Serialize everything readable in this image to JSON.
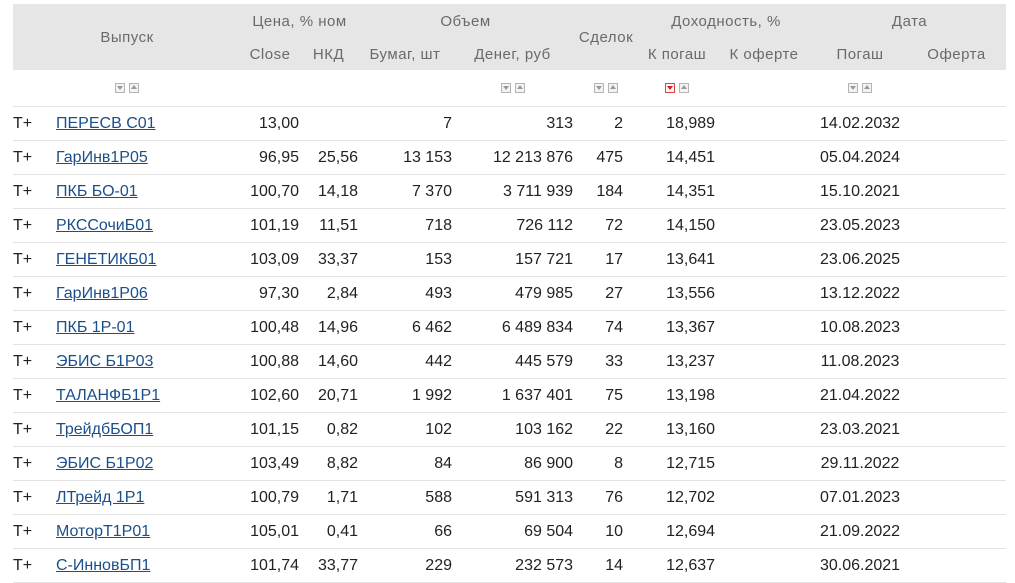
{
  "header": {
    "issue": "Выпуск",
    "price_group": "Цена, % ном",
    "volume_group": "Объем",
    "deals": "Сделок",
    "yield_group": "Доходность, %",
    "date_group": "Дата",
    "close": "Close",
    "nkd": "НКД",
    "papers": "Бумаг, шт",
    "money": "Денег, руб",
    "to_maturity": "К погаш",
    "to_offer": "К оферте",
    "maturity": "Погаш",
    "offer": "Оферта"
  },
  "sort_icons": {
    "inactive_icon": "sort-arrow-icon",
    "active_icon": "sort-desc-active-icon",
    "active_color": "#d81e1e"
  },
  "rows": [
    {
      "mode": "T+",
      "issue": "ПЕРЕСВ С01",
      "close": "13,00",
      "nkd": "",
      "papers": "7",
      "money": "313",
      "deals": "2",
      "yield": "18,989",
      "yield_offer": "",
      "maturity": "14.02.2032",
      "offer": ""
    },
    {
      "mode": "T+",
      "issue": "ГарИнв1Р05",
      "close": "96,95",
      "nkd": "25,56",
      "papers": "13 153",
      "money": "12 213 876",
      "deals": "475",
      "yield": "14,451",
      "yield_offer": "",
      "maturity": "05.04.2024",
      "offer": ""
    },
    {
      "mode": "T+",
      "issue": "ПКБ БО-01",
      "close": "100,70",
      "nkd": "14,18",
      "papers": "7 370",
      "money": "3 711 939",
      "deals": "184",
      "yield": "14,351",
      "yield_offer": "",
      "maturity": "15.10.2021",
      "offer": ""
    },
    {
      "mode": "T+",
      "issue": "РКССочиБ01",
      "close": "101,19",
      "nkd": "11,51",
      "papers": "718",
      "money": "726 112",
      "deals": "72",
      "yield": "14,150",
      "yield_offer": "",
      "maturity": "23.05.2023",
      "offer": ""
    },
    {
      "mode": "T+",
      "issue": "ГЕНЕТИКБ01",
      "close": "103,09",
      "nkd": "33,37",
      "papers": "153",
      "money": "157 721",
      "deals": "17",
      "yield": "13,641",
      "yield_offer": "",
      "maturity": "23.06.2025",
      "offer": ""
    },
    {
      "mode": "T+",
      "issue": "ГарИнв1Р06",
      "close": "97,30",
      "nkd": "2,84",
      "papers": "493",
      "money": "479 985",
      "deals": "27",
      "yield": "13,556",
      "yield_offer": "",
      "maturity": "13.12.2022",
      "offer": ""
    },
    {
      "mode": "T+",
      "issue": "ПКБ 1Р-01",
      "close": "100,48",
      "nkd": "14,96",
      "papers": "6 462",
      "money": "6 489 834",
      "deals": "74",
      "yield": "13,367",
      "yield_offer": "",
      "maturity": "10.08.2023",
      "offer": ""
    },
    {
      "mode": "T+",
      "issue": "ЭБИС Б1Р03",
      "close": "100,88",
      "nkd": "14,60",
      "papers": "442",
      "money": "445 579",
      "deals": "33",
      "yield": "13,237",
      "yield_offer": "",
      "maturity": "11.08.2023",
      "offer": ""
    },
    {
      "mode": "T+",
      "issue": "ТАЛАНФБ1Р1",
      "close": "102,60",
      "nkd": "20,71",
      "papers": "1 992",
      "money": "1 637 401",
      "deals": "75",
      "yield": "13,198",
      "yield_offer": "",
      "maturity": "21.04.2022",
      "offer": ""
    },
    {
      "mode": "T+",
      "issue": "ТрейдбБОП1",
      "close": "101,15",
      "nkd": "0,82",
      "papers": "102",
      "money": "103 162",
      "deals": "22",
      "yield": "13,160",
      "yield_offer": "",
      "maturity": "23.03.2021",
      "offer": ""
    },
    {
      "mode": "T+",
      "issue": "ЭБИС Б1Р02",
      "close": "103,49",
      "nkd": "8,82",
      "papers": "84",
      "money": "86 900",
      "deals": "8",
      "yield": "12,715",
      "yield_offer": "",
      "maturity": "29.11.2022",
      "offer": ""
    },
    {
      "mode": "T+",
      "issue": "ЛТрейд 1Р1",
      "close": "100,79",
      "nkd": "1,71",
      "papers": "588",
      "money": "591 313",
      "deals": "76",
      "yield": "12,702",
      "yield_offer": "",
      "maturity": "07.01.2023",
      "offer": ""
    },
    {
      "mode": "T+",
      "issue": "МоторТ1Р01",
      "close": "105,01",
      "nkd": "0,41",
      "papers": "66",
      "money": "69 504",
      "deals": "10",
      "yield": "12,694",
      "yield_offer": "",
      "maturity": "21.09.2022",
      "offer": ""
    },
    {
      "mode": "T+",
      "issue": "С-ИнновБП1",
      "close": "101,74",
      "nkd": "33,77",
      "papers": "229",
      "money": "232 573",
      "deals": "14",
      "yield": "12,637",
      "yield_offer": "",
      "maturity": "30.06.2021",
      "offer": ""
    }
  ]
}
